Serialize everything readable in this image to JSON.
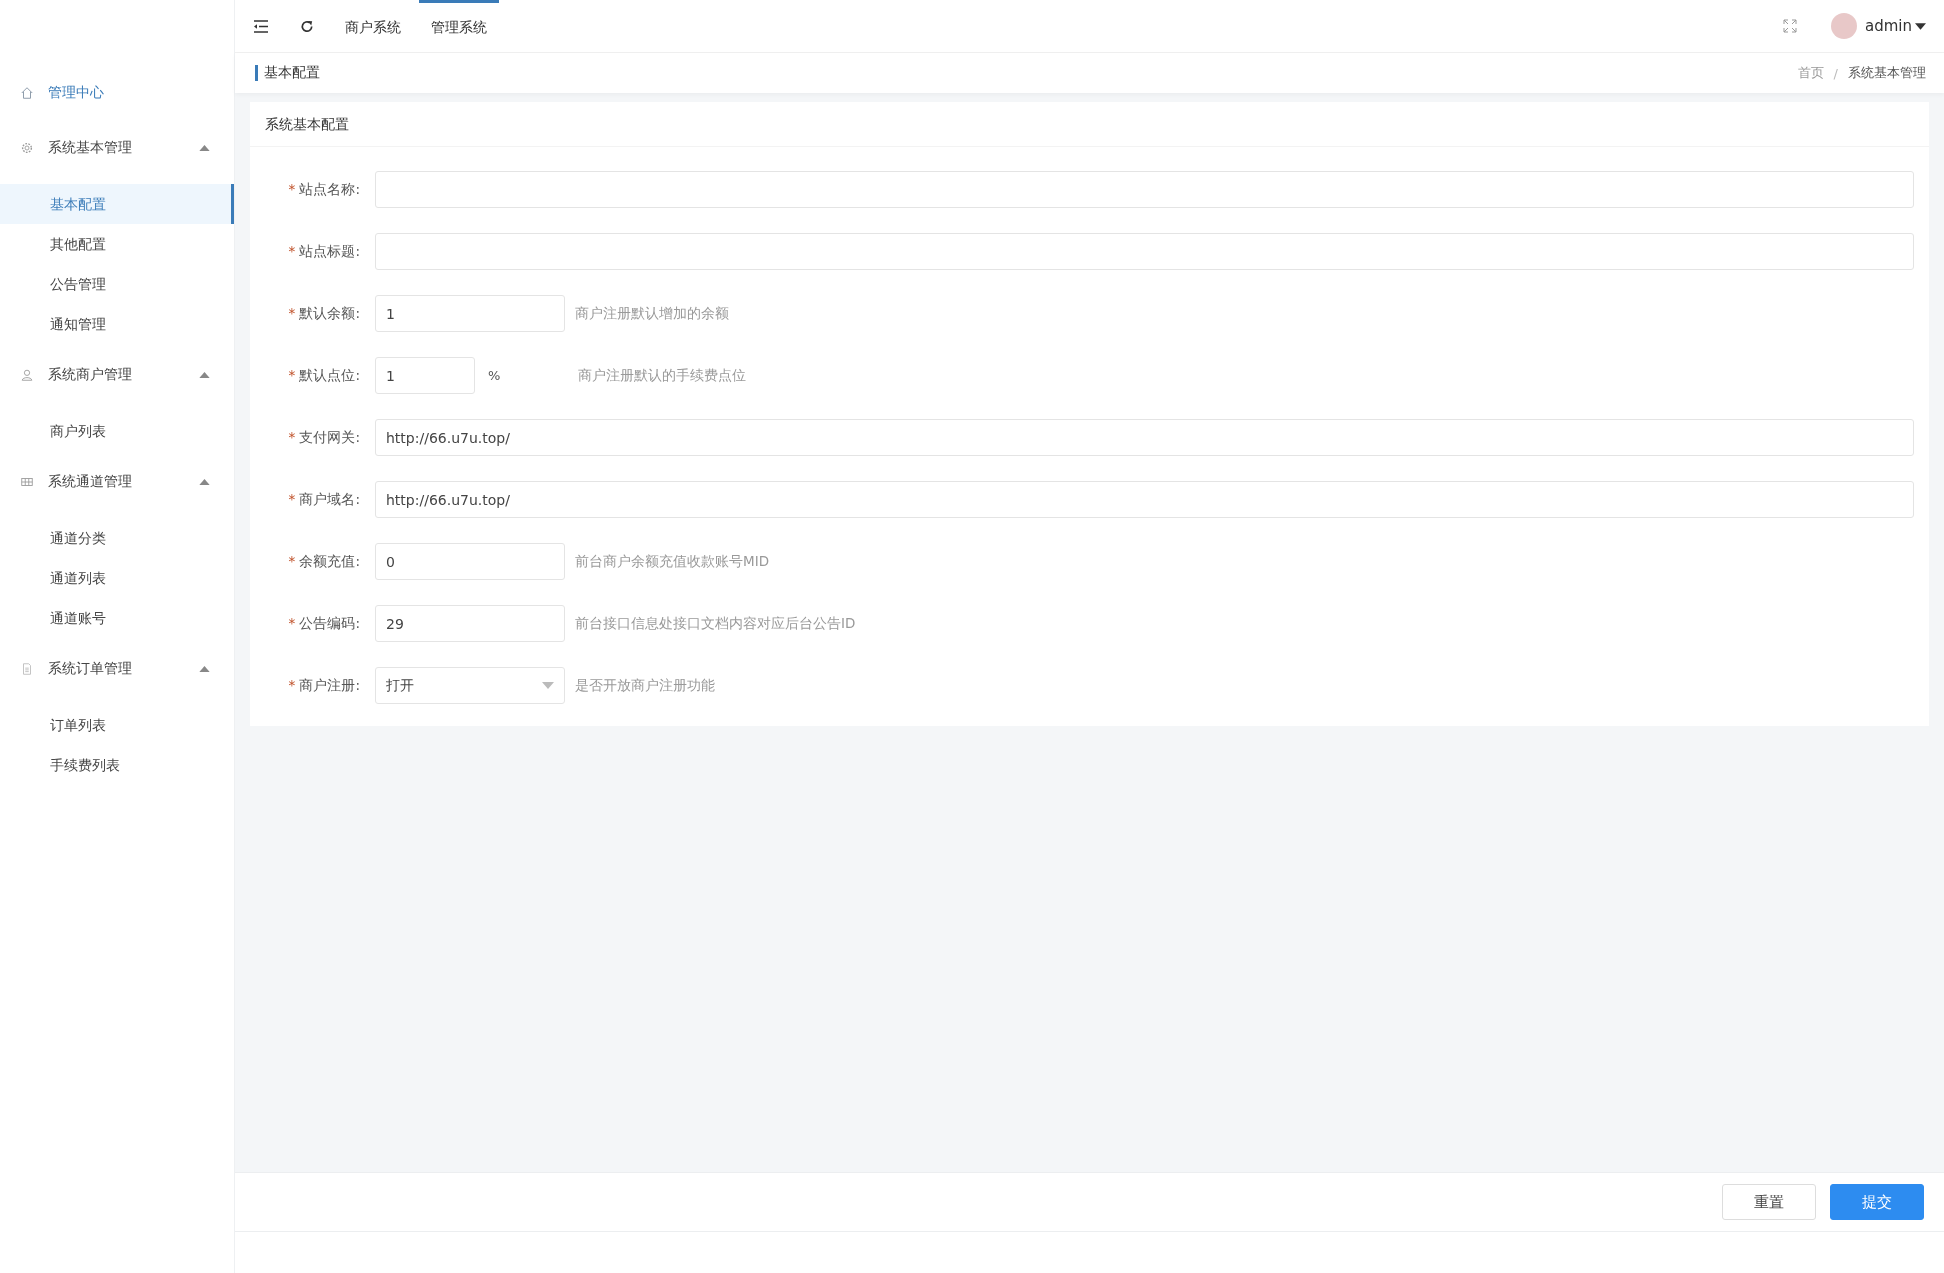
{
  "sidebar": {
    "home": {
      "label": "管理中心"
    },
    "groups": [
      {
        "label": "系统基本管理",
        "expanded": true,
        "items": [
          {
            "label": "基本配置",
            "selected": true
          },
          {
            "label": "其他配置",
            "selected": false
          },
          {
            "label": "公告管理",
            "selected": false
          },
          {
            "label": "通知管理",
            "selected": false
          }
        ]
      },
      {
        "label": "系统商户管理",
        "expanded": true,
        "items": [
          {
            "label": "商户列表",
            "selected": false
          }
        ]
      },
      {
        "label": "系统通道管理",
        "expanded": true,
        "items": [
          {
            "label": "通道分类",
            "selected": false
          },
          {
            "label": "通道列表",
            "selected": false
          },
          {
            "label": "通道账号",
            "selected": false
          }
        ]
      },
      {
        "label": "系统订单管理",
        "expanded": true,
        "items": [
          {
            "label": "订单列表",
            "selected": false
          },
          {
            "label": "手续费列表",
            "selected": false
          }
        ]
      }
    ]
  },
  "topbar": {
    "tabs": [
      {
        "label": "商户系统",
        "selected": false
      },
      {
        "label": "管理系统",
        "selected": true
      }
    ],
    "user": "admin"
  },
  "page_header": {
    "title": "基本配置",
    "breadcrumb": [
      "首页",
      "系统基本管理"
    ],
    "separator": "/"
  },
  "card": {
    "title": "系统基本配置",
    "fields": [
      {
        "label": "站点名称:",
        "marker": "*",
        "kind": "wide"
      },
      {
        "label": "站点标题:",
        "marker": "*",
        "kind": "wide"
      },
      {
        "label": "默认余额:",
        "marker": "*",
        "kind": "short",
        "value": "1",
        "hint": "商户注册默认增加的余额"
      },
      {
        "label": "默认点位:",
        "marker": "*",
        "kind": "narrow",
        "value": "1",
        "unit": "%",
        "hint": "商户注册默认的手续费点位"
      },
      {
        "label": "支付网关:",
        "marker": "*",
        "kind": "wide",
        "value": "http://66.u7u.top/"
      },
      {
        "label": "商户域名:",
        "marker": "*",
        "kind": "wide",
        "value": "http://66.u7u.top/"
      },
      {
        "label": "余额充值:",
        "marker": "*",
        "kind": "short",
        "value": "0",
        "hint": "前台商户余额充值收款账号MID"
      },
      {
        "label": "公告编码:",
        "marker": "*",
        "kind": "short",
        "value": "29",
        "hint": "前台接口信息处接口文档内容对应后台公告ID"
      },
      {
        "label": "商户注册:",
        "marker": "*",
        "kind": "select",
        "value": "打开",
        "hint": "是否开放商户注册功能"
      }
    ]
  },
  "footer": {
    "buttons": [
      {
        "label": "重置",
        "kind": "default"
      },
      {
        "label": "提交",
        "kind": "primary"
      }
    ]
  }
}
